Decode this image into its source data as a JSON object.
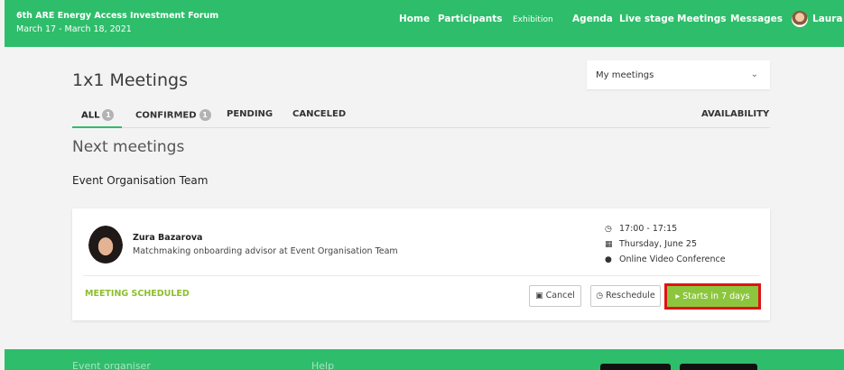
{
  "topbar": {
    "event_title": "6th ARE Energy Access Investment Forum",
    "event_dates": "March 17 - March 18, 2021",
    "nav": [
      "Home",
      "Participants",
      "Exhibition",
      "Agenda",
      "Live stage",
      "Meetings",
      "Messages"
    ],
    "user_name": "Laura"
  },
  "page": {
    "title": "1x1 Meetings",
    "filter_value": "My meetings",
    "tabs": [
      {
        "label": "ALL",
        "count": "1"
      },
      {
        "label": "CONFIRMED",
        "count": "1"
      },
      {
        "label": "PENDING"
      },
      {
        "label": "CANCELED"
      }
    ],
    "availability_label": "AVAILABILITY",
    "section_title": "Next meetings",
    "group_name": "Event Organisation Team"
  },
  "meeting": {
    "name": "Zura Bazarova",
    "role": "Matchmaking onboarding advisor at Event Organisation Team",
    "time": "17:00 - 17:15",
    "date": "Thursday, June 25",
    "location": "Online Video Conference",
    "status": "MEETING SCHEDULED",
    "cancel_label": "Cancel",
    "reschedule_label": "Reschedule",
    "start_label": "Starts in 7 days"
  },
  "footer": {
    "col1": "Event organiser",
    "col2": "Help"
  },
  "colors": {
    "brand_green": "#2ebd6b",
    "status_green": "#8cbe2c",
    "highlight_red": "#e01313"
  }
}
